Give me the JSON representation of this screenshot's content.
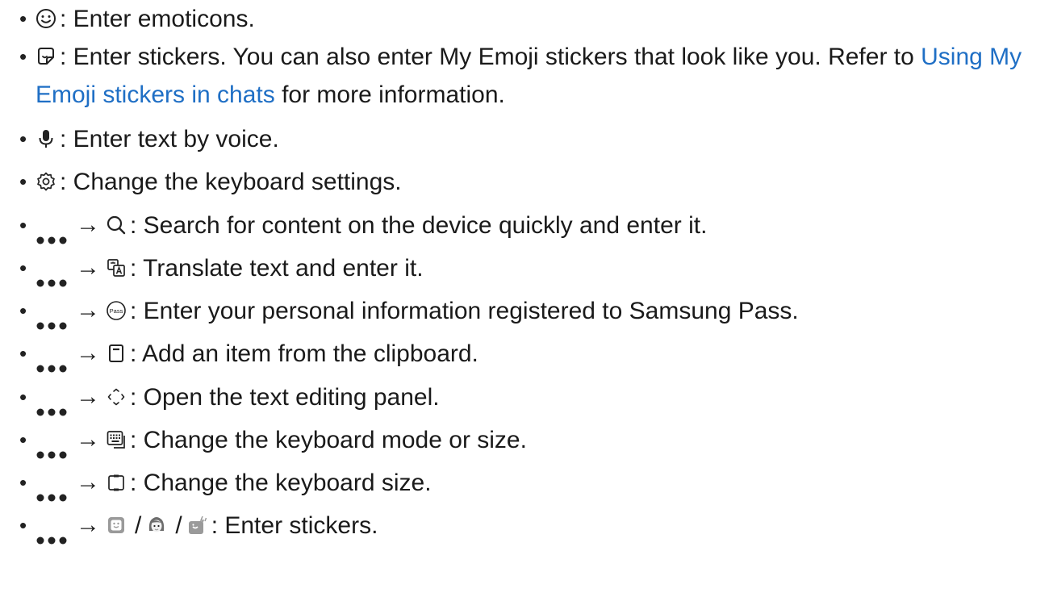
{
  "items": [
    {
      "text": ": Enter emoticons."
    },
    {
      "text": ": Enter stickers. You can also enter My Emoji stickers that look like you. Refer to ",
      "link": "Using My Emoji stickers in chats",
      "text2": " for more information."
    },
    {
      "text": ": Enter text by voice."
    },
    {
      "text": ": Change the keyboard settings."
    },
    {
      "text": ": Search for content on the device quickly and enter it."
    },
    {
      "text": ": Translate text and enter it."
    },
    {
      "text": ": Enter your personal information registered to Samsung Pass."
    },
    {
      "text": ": Add an item from the clipboard."
    },
    {
      "text": ": Open the text editing panel."
    },
    {
      "text": ": Change the keyboard mode or size."
    },
    {
      "text": ": Change the keyboard size."
    },
    {
      "text": ": Enter stickers."
    }
  ],
  "bullet": "•",
  "arrow": "→",
  "slash": "/",
  "pass_label": "Pass",
  "icons": [
    "smiley-icon",
    "sticker-icon",
    "microphone-icon",
    "gear-icon",
    "search-icon",
    "translate-icon",
    "samsung-pass-icon",
    "clipboard-icon",
    "text-editing-icon",
    "keyboard-mode-icon",
    "keyboard-size-icon",
    "sticker-pack-icon",
    "emoji-avatar-icon",
    "animated-sticker-icon"
  ],
  "colors": {
    "text": "#1a1a1a",
    "link": "#1f6fc5"
  }
}
